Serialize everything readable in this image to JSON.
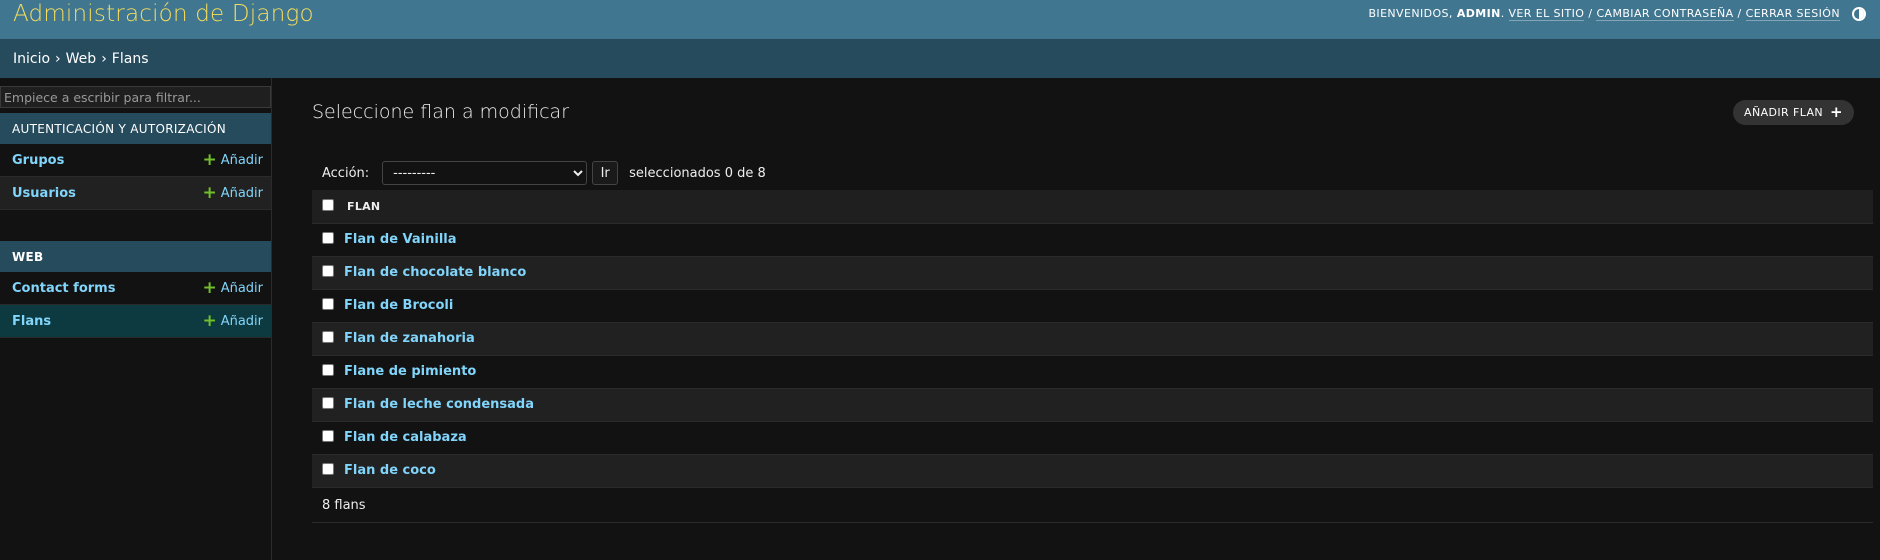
{
  "header": {
    "site_title": "Administración de Django",
    "welcome": "BIENVENIDOS,",
    "username": "ADMIN",
    "view_site": "VER EL SITIO",
    "change_password": "CAMBIAR CONTRASEÑA",
    "logout": "CERRAR SESIÓN",
    "theme_icon": "theme-toggle-icon"
  },
  "breadcrumbs": {
    "home": "Inicio",
    "app": "Web",
    "current": "Flans",
    "separator": "›"
  },
  "sidebar": {
    "filter_placeholder": "Empiece a escribir para filtrar...",
    "modules": [
      {
        "caption": "AUTENTICACIÓN Y AUTORIZACIÓN",
        "models": [
          {
            "name": "Grupos",
            "add": "Añadir"
          },
          {
            "name": "Usuarios",
            "add": "Añadir"
          }
        ]
      },
      {
        "caption": "WEB",
        "models": [
          {
            "name": "Contact forms",
            "add": "Añadir"
          },
          {
            "name": "Flans",
            "add": "Añadir"
          }
        ]
      }
    ]
  },
  "main": {
    "heading": "Seleccione flan a modificar",
    "add_button": "AÑADIR FLAN",
    "action_label": "Acción:",
    "action_selected": "---------",
    "go_button": "Ir",
    "selection_counter": "seleccionados 0 de 8",
    "column_header": "FLAN",
    "rows": [
      "Flan de Vainilla",
      "Flan de chocolate blanco",
      "Flan de Brocoli",
      "Flan de zanahoria",
      "Flane de pimiento",
      "Flan de leche condensada",
      "Flan de calabaza",
      "Flan de coco"
    ],
    "result_count": "8 flans"
  },
  "colors": {
    "header_bg": "#417690",
    "title": "#f5dd5d",
    "breadcrumb_bg": "#264b5d",
    "link": "#81d4fa",
    "add_icon": "#70bf2b",
    "body_bg": "#121212"
  }
}
